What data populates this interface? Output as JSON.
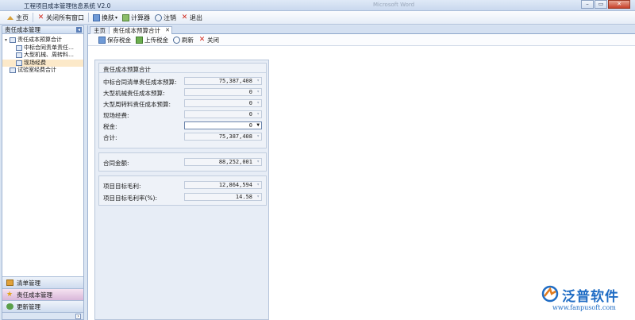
{
  "window": {
    "title": "工程项目成本管理信息系统 V2.0",
    "ghost_text": "Microsoft Word"
  },
  "toolbar": {
    "home": "主页",
    "close_all": "关闭所有窗口",
    "switch": "换肤",
    "calculator": "计算器",
    "logout": "注销",
    "exit": "退出"
  },
  "sidebar": {
    "header": "责任成本管理",
    "tree": {
      "root": "责任成本预算合计",
      "children": [
        "中标合同责单责任…",
        "大型机械、周转料…",
        "现场经费"
      ],
      "second_root": "试验室经费合计"
    },
    "modules": [
      "清单管理",
      "责任成本管理",
      "更新管理"
    ]
  },
  "tabs": [
    {
      "label": "主页"
    },
    {
      "label": "责任成本预算合计"
    }
  ],
  "subtoolbar": {
    "save_tax": "保存税金",
    "upload_tax": "上传税金",
    "refresh": "刷新",
    "close": "关闭"
  },
  "form": {
    "group_title": "责任成本预算合计",
    "rows": [
      {
        "label": "中标合同清单责任成本预算:",
        "value": "75,387,408"
      },
      {
        "label": "大型机械责任成本预算:",
        "value": "0"
      },
      {
        "label": "大型周转料责任成本预算:",
        "value": "0"
      },
      {
        "label": "现场经费:",
        "value": "0"
      },
      {
        "label": "税金:",
        "value": "0"
      },
      {
        "label": "合计:",
        "value": "75,387,408"
      }
    ],
    "contract_label": "合同金额:",
    "contract_value": "88,252,001",
    "profit_label": "项目目标毛利:",
    "profit_value": "12,864,594",
    "margin_label": "项目目标毛利率(%):",
    "margin_value": "14.58"
  },
  "logo": {
    "name": "泛普软件",
    "url": "www.fanpusoft.com"
  },
  "colors": {
    "accent": "#1f6cc4",
    "close_red": "#c6402a"
  }
}
